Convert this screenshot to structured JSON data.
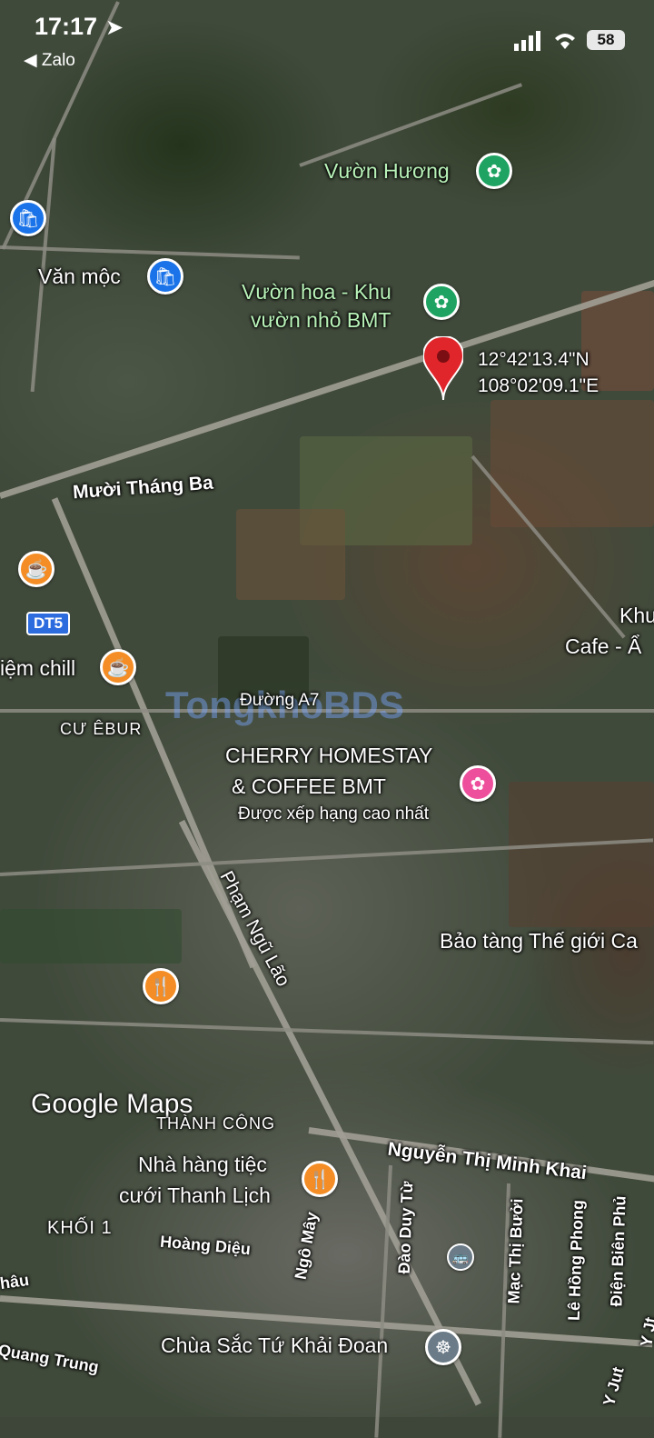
{
  "status_bar": {
    "time": "17:17",
    "back_app": "◀ Zalo",
    "battery": "58"
  },
  "dropped_pin": {
    "lat": "12°42'13.4\"N",
    "lng": "108°02'09.1\"E"
  },
  "places": {
    "vuon_huong": "Vườn Hương",
    "van_moc": "Văn mộc",
    "vuon_hoa_1": "Vườn hoa - Khu",
    "vuon_hoa_2": "vườn nhỏ BMT",
    "tiem_chill": "iệm chill",
    "khu_cafe_1": "Khu",
    "khu_cafe_2": "Cafe - Ẩ",
    "cherry_1": "CHERRY HOMESTAY",
    "cherry_2": "& COFFEE BMT",
    "cherry_rating": "Được xếp hạng cao nhất",
    "bao_tang": "Bảo tàng Thế giới Ca",
    "nha_hang_1": "Nhà hàng tiệc",
    "nha_hang_2": "cưới Thanh Lịch",
    "chua": "Chùa Sắc Tứ Khải Đoan"
  },
  "streets": {
    "muoi_thang_ba": "Mười Tháng Ba",
    "dt5": "DT5",
    "duong_a7": "Đường A7",
    "pham_ngu_lao": "Phạm Ngũ Lão",
    "nguyen_thi_minh_khai": "Nguyễn Thị Minh Khai",
    "hoang_dieu": "Hoàng Diệu",
    "ngo_may": "Ngô Mây",
    "dao_duy_tu": "Đào Duy Từ",
    "mac_thi_buoi": "Mạc Thị Bưởi",
    "le_hong_phong": "Lê Hồng Phong",
    "dien_bien_phu": "Điện Biên Phủ",
    "quang_trung": "Quang Trung",
    "hau": "hâu",
    "y_jut": "Y Jut",
    "y_jut_2": "Y Jt"
  },
  "areas": {
    "cu_ebur": "CƯ ÊBUR",
    "thanh_cong": "THÀNH CÔNG",
    "khoi_1": "KHỐI 1"
  },
  "google_maps_logo": "Google Maps",
  "watermark": "TongkhoBDS",
  "icons": {
    "flower": "flower-icon",
    "shopping": "shopping-bag-icon",
    "coffee": "coffee-icon",
    "restaurant": "restaurant-icon",
    "homestay": "homestay-icon",
    "temple": "temple-icon",
    "bus": "bus-icon",
    "pin": "red-pin-icon"
  }
}
